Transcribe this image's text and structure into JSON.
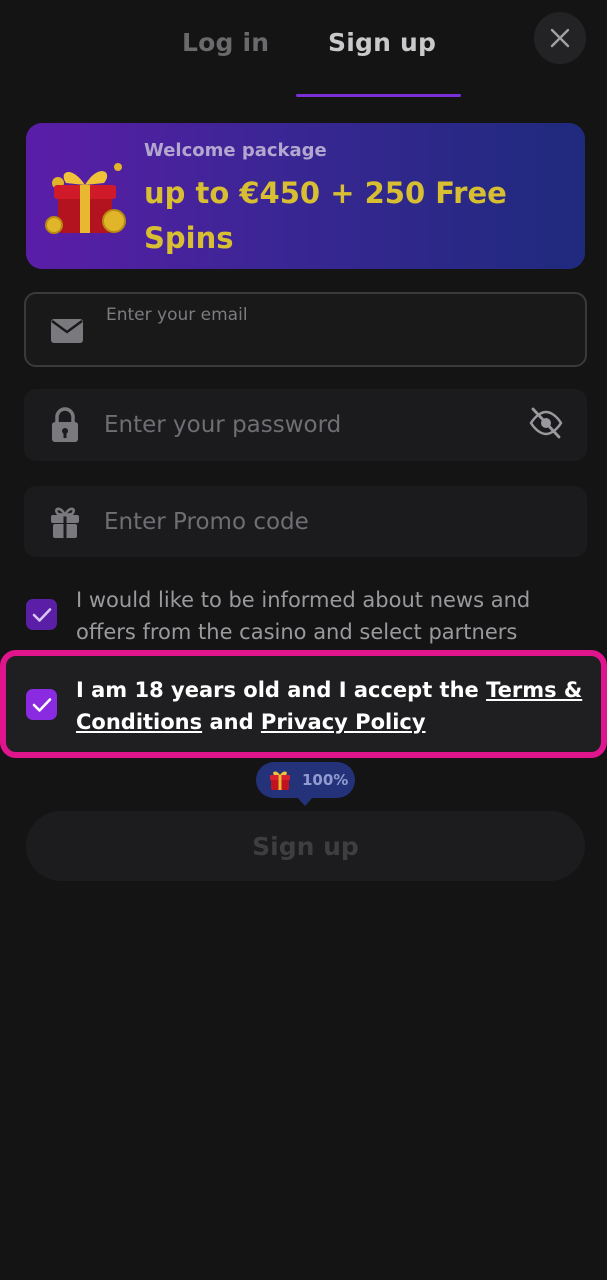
{
  "tabs": {
    "login": "Log in",
    "signup": "Sign up"
  },
  "close": {
    "icon": "close-icon"
  },
  "banner": {
    "subtitle": "Welcome package",
    "title": "up to €450 + 250 Free Spins",
    "icon": "gift-box-icon"
  },
  "email": {
    "label": "Enter your email",
    "value": "",
    "icon": "envelope-icon"
  },
  "password": {
    "placeholder": "Enter your password",
    "icon": "lock-icon",
    "toggle_icon": "eye-off-icon"
  },
  "promo": {
    "placeholder": "Enter Promo code",
    "icon": "gift-icon"
  },
  "news_checkbox": {
    "checked": true,
    "label": "I would like to be informed about news and offers from the casino and select partners"
  },
  "terms_checkbox": {
    "checked": true,
    "label_prefix": "I am 18 years old and I accept the ",
    "terms_link": "Terms & Conditions",
    "label_middle": " and ",
    "privacy_link": "Privacy Policy"
  },
  "badge": {
    "text": "100%",
    "icon": "gift-box-icon"
  },
  "signup_button": {
    "label": "Sign up"
  },
  "colors": {
    "background": "#141414",
    "accent_purple": "#8a2be2",
    "banner_gold": "#d8bf32",
    "highlight_pink": "#e0148c"
  }
}
